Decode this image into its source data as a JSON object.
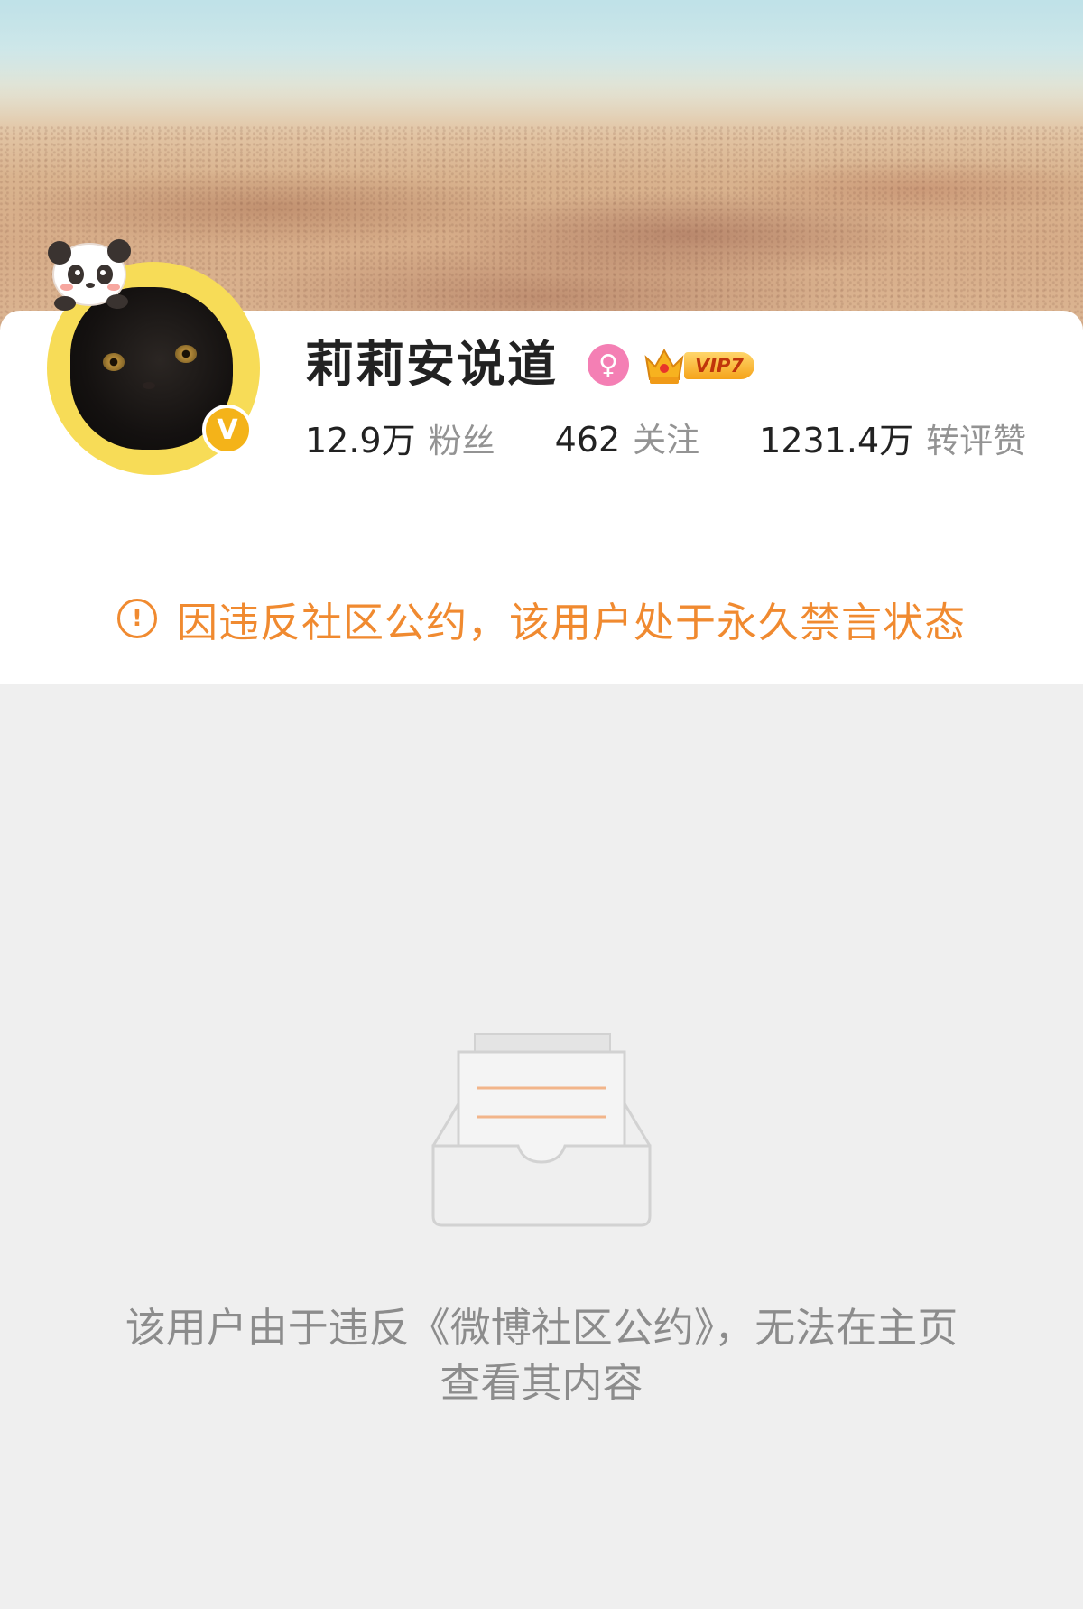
{
  "profile": {
    "name": "莉莉安说道",
    "gender_icon": "female-icon",
    "vip_badge": "VIP7",
    "verified_badge": "V",
    "stats": [
      {
        "value": "12.9万",
        "label": "粉丝"
      },
      {
        "value": "462",
        "label": "关注"
      },
      {
        "value": "1231.4万",
        "label": "转评赞"
      }
    ]
  },
  "notice": {
    "icon": "!",
    "text": "因违反社区公约，该用户处于永久禁言状态"
  },
  "empty_state": {
    "message": "该用户由于违反《微博社区公约》，无法在主页查看其内容"
  },
  "colors": {
    "accent_orange": "#f08a30",
    "avatar_ring": "#f7dc57",
    "verified": "#f4b319",
    "gender": "#f47fb4"
  }
}
